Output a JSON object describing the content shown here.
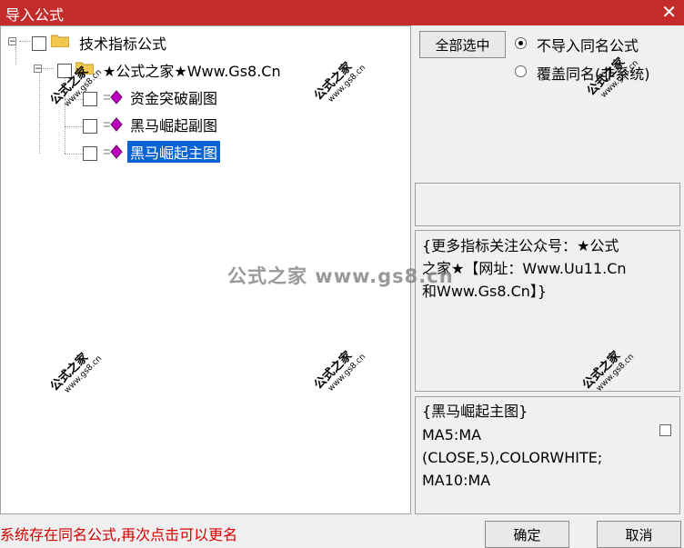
{
  "window": {
    "title": "导入公式",
    "close_glyph": "✕"
  },
  "tree": {
    "root": {
      "label": "技术指标公式",
      "expand": "−"
    },
    "group": {
      "label": "★公式之家★Www.Gs8.Cn",
      "expand": "−"
    },
    "items": [
      {
        "label": "资金突破副图",
        "selected": false
      },
      {
        "label": "黑马崛起副图",
        "selected": false
      },
      {
        "label": "黑马崛起主图",
        "selected": true
      }
    ]
  },
  "toolbar": {
    "select_all_label": "全部选中"
  },
  "options": {
    "radio1": {
      "label": "不导入同名公式",
      "checked": true
    },
    "radio2": {
      "label": "覆盖同名(非系统)",
      "checked": false
    }
  },
  "description": {
    "lines": [
      "{更多指标关注公众号：★公式",
      "之家★【网址：Www.Uu11.Cn",
      "和Www.Gs8.Cn】}"
    ]
  },
  "code": {
    "lines": [
      "{黑马崛起主图}",
      "MA5:MA",
      "(CLOSE,5),COLORWHITE;",
      "MA10:MA"
    ]
  },
  "watermark": {
    "name": "公式之家",
    "site": "www.gs8.cn",
    "big": "公式之家 www.gs8.cn"
  },
  "status": {
    "text": "系统存在同名公式,再次点击可以更名"
  },
  "buttons": {
    "ok_label": "确定",
    "cancel_label": "取消"
  }
}
